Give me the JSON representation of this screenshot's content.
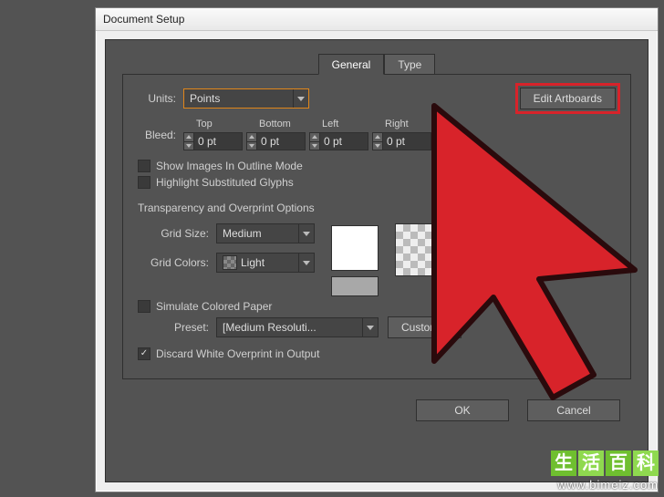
{
  "window": {
    "title": "Document Setup"
  },
  "tabs": {
    "general": "General",
    "type": "Type"
  },
  "units": {
    "label": "Units:",
    "value": "Points"
  },
  "edit_artboards": "Edit Artboards",
  "bleed": {
    "label": "Bleed:",
    "top_label": "Top",
    "bottom_label": "Bottom",
    "left_label": "Left",
    "right_label": "Right",
    "top": "0 pt",
    "bottom": "0 pt",
    "left": "0 pt",
    "right": "0 pt"
  },
  "checks": {
    "show_images": "Show Images In Outline Mode",
    "highlight_glyphs": "Highlight Substituted Glyphs",
    "simulate_paper": "Simulate Colored Paper",
    "discard_white": "Discard White Overprint in Output"
  },
  "transparency": {
    "title": "Transparency and Overprint Options",
    "grid_size_label": "Grid Size:",
    "grid_size": "Medium",
    "grid_colors_label": "Grid Colors:",
    "grid_colors": "Light",
    "preset_label": "Preset:",
    "preset": "[Medium Resoluti...",
    "custom": "Custom..."
  },
  "footer": {
    "ok": "OK",
    "cancel": "Cancel"
  },
  "watermark": {
    "c1": "生",
    "c2": "活",
    "c3": "百",
    "c4": "科",
    "url": "www.bimeiz.com"
  }
}
